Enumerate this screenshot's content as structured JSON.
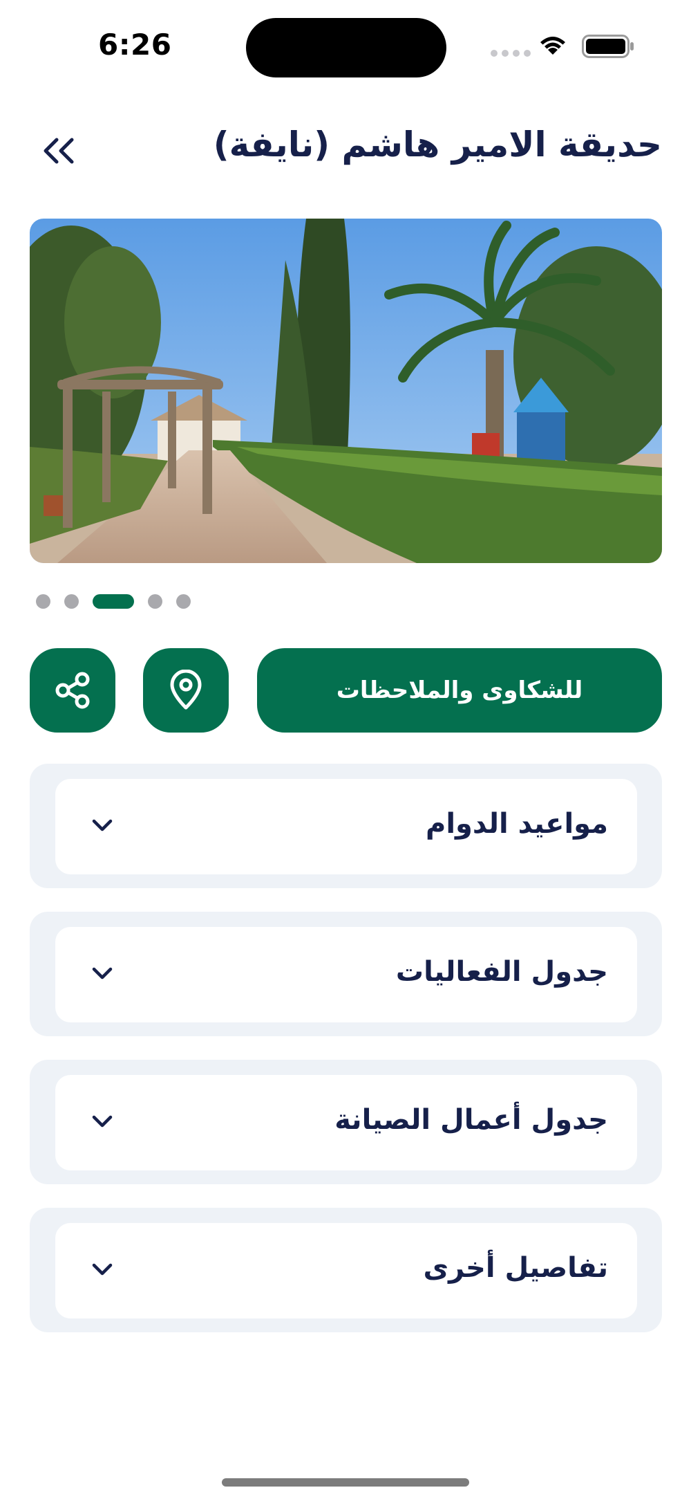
{
  "status_bar": {
    "time": "6:26"
  },
  "header": {
    "title": "حديقة الامير هاشم (نايفة)",
    "back_icon": "double-chevron-left-icon"
  },
  "carousel": {
    "total_slides": 5,
    "active_index": 2
  },
  "actions": {
    "complaints_label": "للشكاوى والملاحظات",
    "location_icon": "map-pin-icon",
    "share_icon": "share-icon"
  },
  "sections": [
    {
      "label": "مواعيد الدوام"
    },
    {
      "label": "جدول الفعاليات"
    },
    {
      "label": "جدول أعمال الصيانة"
    },
    {
      "label": "تفاصيل أخرى"
    }
  ],
  "colors": {
    "primary": "#04704f",
    "title": "#16204a",
    "card_bg": "#eef2f7",
    "dot_inactive": "#a9a9ad"
  }
}
